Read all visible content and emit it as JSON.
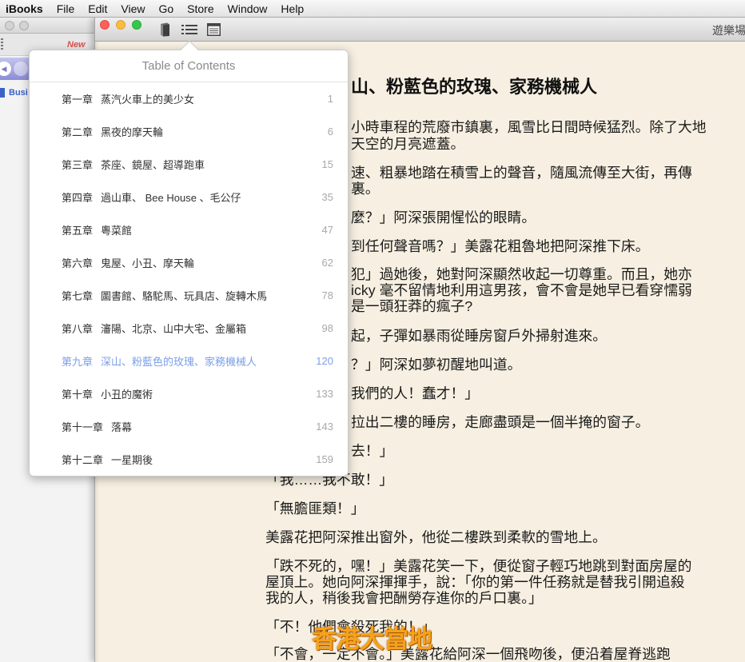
{
  "menubar": {
    "app": "iBooks",
    "items": [
      "File",
      "Edit",
      "View",
      "Go",
      "Store",
      "Window",
      "Help"
    ]
  },
  "background_window": {
    "toolbar_label": "New",
    "sidebar_label": "Busi",
    "icons": [
      "back-arrow-icon",
      "forward-arrow-icon",
      "grip-icon"
    ]
  },
  "reader": {
    "title": "遊樂場",
    "toolbar_icons": [
      "library-icon",
      "table-of-contents-icon",
      "notes-icon"
    ],
    "heading": "山、粉藍色的玫瑰、家務機械人",
    "lines": [
      "小時車程的荒廢市鎮裏，風雪比日間時候猛烈。除了大地",
      "天空的月亮遮蓋。",
      "速、粗暴地踏在積雪上的聲音，隨風流傳至大街，再傳",
      "裏。",
      "麼？」阿深張開惺忪的眼睛。",
      "到任何聲音嗎？」美露花粗魯地把阿深推下床。",
      "犯」過她後，她對阿深顯然收起一切尊重。而且，她亦",
      "icky 毫不留情地利用這男孩，會不會是她早已看穿懦弱",
      "是一頭狂莽的瘋子?",
      "起，子彈如暴雨從睡房窗戶外掃射進來。",
      "？」阿深如夢初醒地叫道。",
      "我們的人！蠢才！」",
      "拉出二樓的睡房，走廊盡頭是一個半掩的窗子。",
      "去！」",
      "「我……我不敢！」",
      "「無膽匪類！」",
      "美露花把阿深推出窗外，他從二樓跌到柔軟的雪地上。",
      "「跌不死的，嘿！」美露花笑一下，便從窗子輕巧地跳到對面房屋的",
      "屋頂上。她向阿深揮揮手，說：「你的第一件任務就是替我引開追殺",
      "我的人，稍後我會把酬勞存進你的戶口裏。」",
      "「不！他們會殺死我的！」",
      "「不會，一定不會。」美露花給阿深一個飛吻後，便沿着屋脊逃跑"
    ]
  },
  "toc": {
    "title": "Table of Contents",
    "current_index": 8,
    "items": [
      {
        "chapter": "第一章",
        "title": "蒸汽火車上的美少女",
        "page": "1"
      },
      {
        "chapter": "第二章",
        "title": "黑夜的摩天輪",
        "page": "6"
      },
      {
        "chapter": "第三章",
        "title": "茶座、鏡屋、超導跑車",
        "page": "15"
      },
      {
        "chapter": "第四章",
        "title": "過山車、 Bee House 、毛公仔",
        "page": "35"
      },
      {
        "chapter": "第五章",
        "title": "粵菜館",
        "page": "47"
      },
      {
        "chapter": "第六章",
        "title": "鬼屋、小丑、摩天輪",
        "page": "62"
      },
      {
        "chapter": "第七章",
        "title": "圖書館、駱駝馬、玩具店、旋轉木馬",
        "page": "78"
      },
      {
        "chapter": "第八章",
        "title": "瀋陽、北京、山中大宅、金屬箱",
        "page": "98"
      },
      {
        "chapter": "第九章",
        "title": "深山、粉藍色的玫瑰、家務機械人",
        "page": "120"
      },
      {
        "chapter": "第十章",
        "title": "小丑的魔術",
        "page": "133"
      },
      {
        "chapter": "第十一章",
        "title": "落幕",
        "page": "143"
      },
      {
        "chapter": "第十二章",
        "title": "一星期後",
        "page": "159"
      }
    ]
  },
  "watermark": "香港大當地",
  "colors": {
    "accent": "#7b9fe8",
    "page_background": "#f7f0e2",
    "watermark": "#f6a21a",
    "close": "#fc605b",
    "minimize": "#fdbc40",
    "zoom": "#34c84a"
  }
}
